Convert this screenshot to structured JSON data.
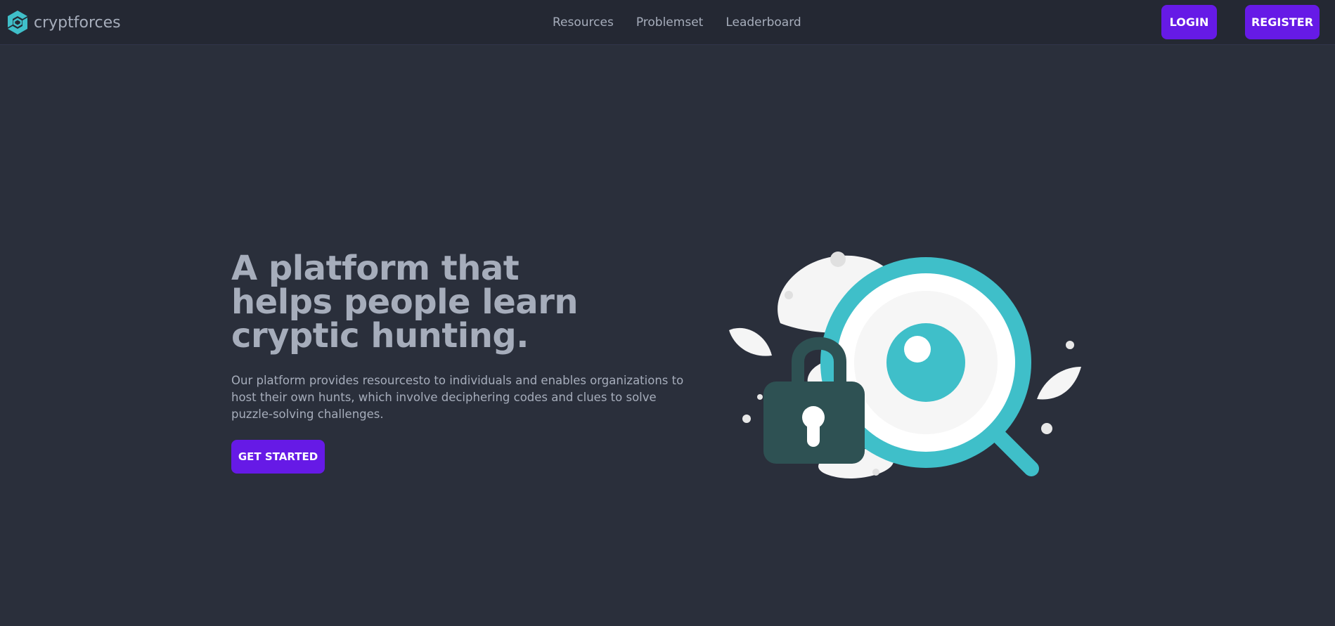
{
  "brand": {
    "name": "cryptforces",
    "logo_icon": "cryptforces-logo-icon"
  },
  "nav": {
    "links": [
      "Resources",
      "Problemset",
      "Leaderboard"
    ]
  },
  "auth": {
    "login_label": "LOGIN",
    "register_label": "REGISTER"
  },
  "hero": {
    "title": "A platform that helps people learn cryptic hunting.",
    "description": "Our platform provides resourcesto to individuals and enables organizations to host their own hunts, which involve deciphering codes and clues to solve puzzle-solving challenges.",
    "cta_label": "GET STARTED",
    "illustration_icon": "magnifier-lock-illustration"
  },
  "colors": {
    "background": "#2a2f3b",
    "navbar": "#242833",
    "text": "#a6adbb",
    "primary": "#661ae6",
    "teal": "#3fbfc9",
    "lock": "#2e5153"
  }
}
